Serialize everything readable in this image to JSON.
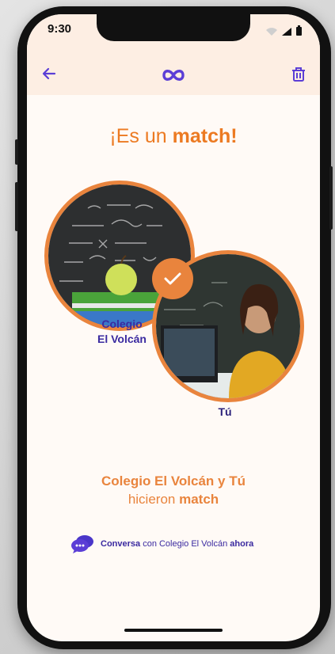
{
  "status": {
    "time": "9:30"
  },
  "header": {
    "back_icon": "arrow-left-icon",
    "logo_icon": "infinity-logo-icon",
    "trash_icon": "trash-icon"
  },
  "main": {
    "title_prefix": "¡Es un ",
    "title_bold": "match!",
    "school_line1": "Colegio",
    "school_line2": "El Volcán",
    "user_name": "Tú",
    "result_line1": "Colegio El Volcán y Tú",
    "result_line2_prefix": "hicieron ",
    "result_line2_bold": "match"
  },
  "chat": {
    "icon": "chat-bubble-icon",
    "bold1": "Conversa",
    "middle": " con Colegio El Volcán ",
    "bold2": "ahora"
  },
  "colors": {
    "accent": "#e9843d",
    "primary": "#5b3ed6",
    "header_bg": "#fdeee3"
  }
}
